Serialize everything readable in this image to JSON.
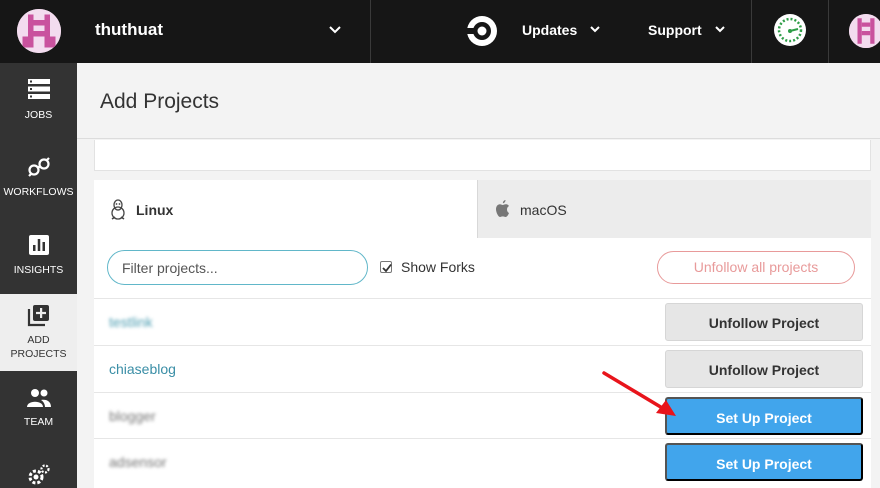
{
  "header": {
    "org_name": "thuthuat",
    "updates_label": "Updates",
    "support_label": "Support"
  },
  "sidebar": {
    "items": [
      {
        "label": "JOBS",
        "icon": "jobs-icon"
      },
      {
        "label": "WORKFLOWS",
        "icon": "workflows-icon"
      },
      {
        "label": "INSIGHTS",
        "icon": "insights-icon"
      },
      {
        "label_line1": "ADD",
        "label_line2": "PROJECTS",
        "icon": "add-projects-icon",
        "active": true
      },
      {
        "label": "TEAM",
        "icon": "team-icon"
      },
      {
        "icon": "settings-icon"
      }
    ]
  },
  "page": {
    "title": "Add Projects"
  },
  "tabs": [
    {
      "label": "Linux",
      "icon": "linux-icon",
      "active": true
    },
    {
      "label": "macOS",
      "icon": "apple-icon",
      "active": false
    }
  ],
  "filter": {
    "placeholder": "Filter projects...",
    "value": ""
  },
  "show_forks": {
    "label": "Show Forks",
    "checked": true
  },
  "unfollow_all_label": "Unfollow all projects",
  "projects": [
    {
      "name": "testlink",
      "blurred": true,
      "action": "Unfollow Project"
    },
    {
      "name": "chiaseblog",
      "blurred": false,
      "action": "Unfollow Project"
    },
    {
      "name": "blogger",
      "blurred": true,
      "action": "Set Up Project"
    },
    {
      "name": "adsensor",
      "blurred": true,
      "action": "Set Up Project"
    }
  ],
  "colors": {
    "topbar": "#161616",
    "sidebar": "#333333",
    "primary_button": "#41a5ec",
    "link": "#3a8ea6",
    "danger_outline": "#e89a9a",
    "arrow": "#e8141b"
  }
}
